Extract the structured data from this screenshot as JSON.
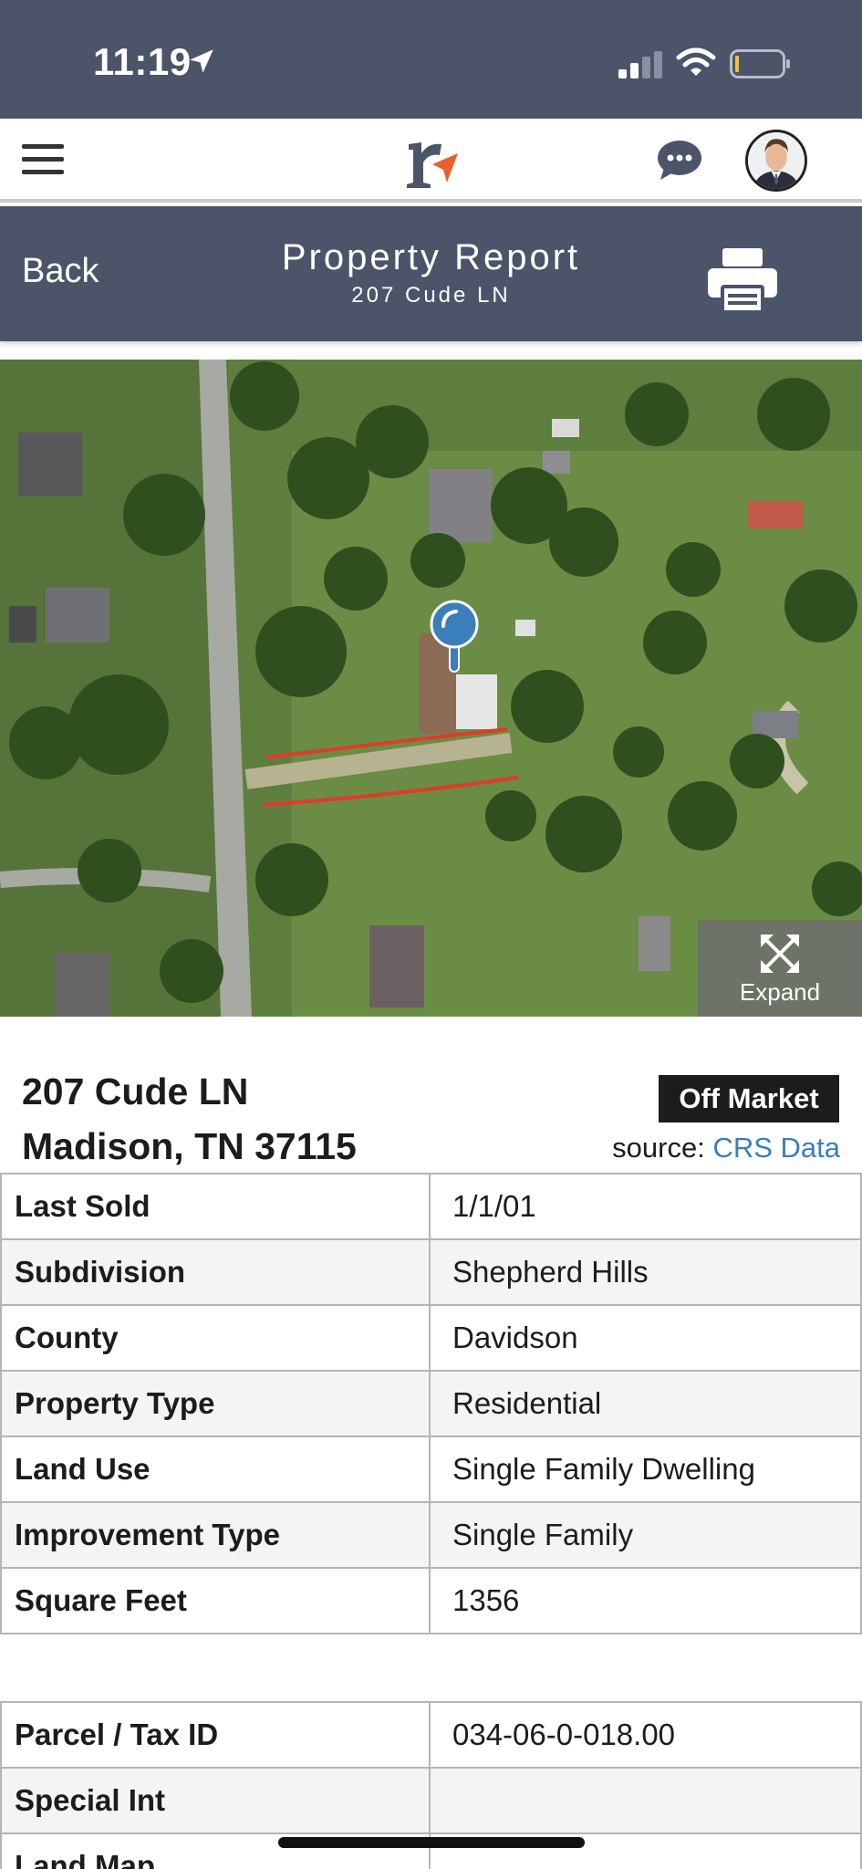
{
  "status_bar": {
    "time": "11:19",
    "icons": [
      "location-arrow-icon",
      "signal-icon",
      "wifi-icon",
      "battery-icon"
    ]
  },
  "app_header": {
    "icons": [
      "menu-icon",
      "logo",
      "chat-icon",
      "avatar"
    ],
    "accent_color": "#e8602c"
  },
  "report_header": {
    "back_label": "Back",
    "title": "Property Report",
    "subtitle": "207 Cude LN",
    "print_icon": "printer-icon",
    "background": "#4b5468"
  },
  "map": {
    "expand_label": "Expand",
    "expand_icon": "expand-arrows-icon",
    "pin_icon": "location-pin-icon",
    "boundary_color": "#e03a2a"
  },
  "property": {
    "address_line1": "207 Cude LN",
    "address_line2": "Madison, TN 37115",
    "status": "Off Market",
    "source_prefix": "source: ",
    "source_name": "CRS Data",
    "link_color": "#3a7ebb"
  },
  "details": [
    {
      "label": "Last Sold",
      "value": "1/1/01"
    },
    {
      "label": "Subdivision",
      "value": "Shepherd Hills"
    },
    {
      "label": "County",
      "value": "Davidson"
    },
    {
      "label": "Property Type",
      "value": "Residential"
    },
    {
      "label": "Land Use",
      "value": "Single Family Dwelling"
    },
    {
      "label": "Improvement Type",
      "value": "Single Family"
    },
    {
      "label": "Square Feet",
      "value": "1356"
    }
  ],
  "tax_details": [
    {
      "label": "Parcel / Tax ID",
      "value": "034-06-0-018.00"
    },
    {
      "label": "Special Int",
      "value": ""
    },
    {
      "label": "Land Map",
      "value": ""
    }
  ]
}
